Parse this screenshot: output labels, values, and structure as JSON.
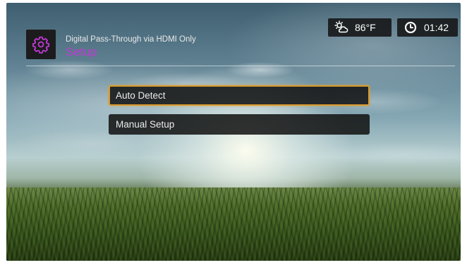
{
  "header": {
    "subtitle": "Digital Pass-Through via HDMI Only",
    "title": "Setup",
    "icon": "gear-icon"
  },
  "status": {
    "temperature": "86°F",
    "weather_icon": "partly-cloudy-icon",
    "time": "01:42",
    "time_icon": "clock-icon"
  },
  "menu": {
    "items": [
      {
        "label": "Auto Detect",
        "selected": true
      },
      {
        "label": "Manual Setup",
        "selected": false
      }
    ]
  },
  "colors": {
    "accent_title": "#c23ad6",
    "selection_border": "#d89a2c",
    "panel_bg": "#1c1c1e"
  }
}
